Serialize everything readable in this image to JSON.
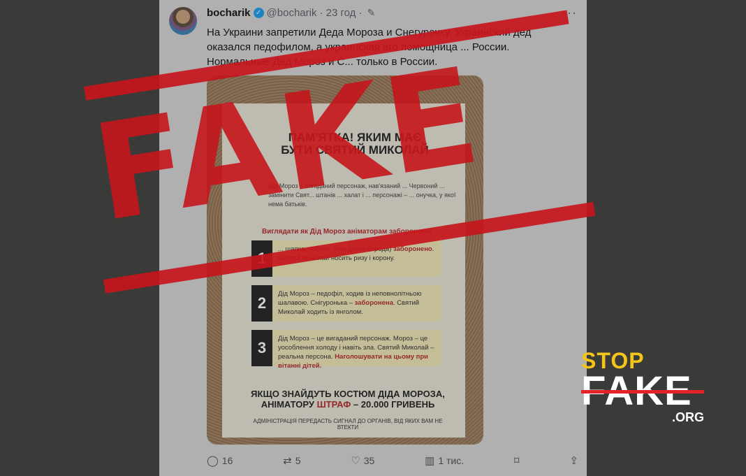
{
  "tweet": {
    "name": "bocharik",
    "handle": "@bocharik",
    "time": "· 23 год ·",
    "text": "На Украини запретили Деда Мороза и Снегурочку. Украинский дед оказался педофилом, а украинская его помощница ... России. Нормальные Дед Мороз и С... только в России."
  },
  "poster": {
    "title": "ПАМ'ЯТКА! ЯКИМ МАЄ БУТИ СВЯТИЙ МИКОЛАЙ",
    "intro": "Дід Мороз – вигаданий персонаж, нав'язаний ... Червоний ... замінити Свят... штанів ... халат і ... персонажі – ... онучка, у якої нема батьків.",
    "forbidden": "Виглядати як Дід Мороз аніматорам заборонено!",
    "steps": [
      {
        "num": "1",
        "text": "... шапка, чоботи, біла довга борода)",
        "bold": "заборонено",
        "text2": ". Святий Миколай носить ризу і корону."
      },
      {
        "num": "2",
        "text": "Дід Мороз – педофіл, ходив із неповнолітньою шалавою. Снігуронька –",
        "bold": "заборонена",
        "text2": ". Святий Миколай ходить із янголом."
      },
      {
        "num": "3",
        "text": "Дід Мороз – це вигаданий персонаж. Мороз – це уособлення холоду і навіть зла. Святий Миколай – реальна персона.",
        "bold": "Наголошувати на цьому при вітанні дітей.",
        "text2": ""
      }
    ],
    "fine_line1": "ЯКЩО ЗНАЙДУТЬ КОСТЮМ ДІДА МОРОЗА,",
    "fine_line2_a": "АНІМАТОРУ",
    "fine_line2_b": "ШТРАФ",
    "fine_line2_c": "– 20.000 ГРИВЕНЬ",
    "admin": "АДМІНІСТРАЦІЯ ПЕРЕДАСТЬ СИГНАЛ ДО ОРГАНІВ, ВІД ЯКИХ ВАМ НЕ ВТЕКТИ"
  },
  "actions": {
    "replies": "16",
    "reposts": "5",
    "likes": "35",
    "views": "1 тис."
  },
  "stamp": {
    "word": "FAKE"
  },
  "logo": {
    "stop": "STOP",
    "fake": "FAKE",
    "org": ".ORG"
  },
  "colors": {
    "stamp_red": "#c5161c",
    "logo_yellow": "#f5c41a",
    "verified_blue": "#1d9bf0"
  },
  "icons": [
    "verified-icon",
    "edit-icon",
    "more-icon",
    "reply-icon",
    "repost-icon",
    "like-icon",
    "views-icon",
    "bookmark-icon",
    "share-icon"
  ]
}
